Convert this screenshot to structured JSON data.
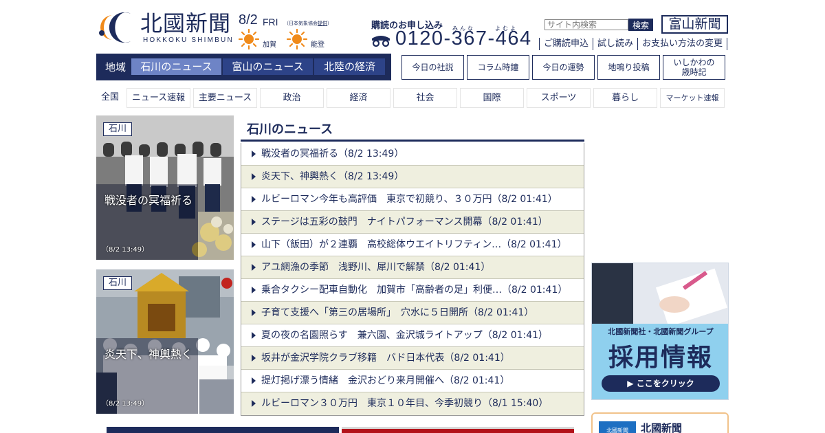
{
  "brand": {
    "name": "北國新聞",
    "romaji": "HOKKOKU SHIMBUN",
    "mark_colors": [
      "#f08a1a",
      "#1d2b5b"
    ]
  },
  "weather": {
    "date": "8/2",
    "day": "FRI",
    "credit_prefix": "（日本気象協会",
    "credit_link": "提供",
    "credit_suffix": "）",
    "cities": [
      {
        "name": "加賀",
        "icon": "sun-icon"
      },
      {
        "name": "能登",
        "icon": "sun-icon"
      }
    ]
  },
  "subscribe": {
    "label": "購読のお申し込み",
    "ruby_1": "みんな",
    "ruby_2": "よむよ",
    "phone": "0120-367-464"
  },
  "search": {
    "placeholder": "サイト内検索",
    "button": "検索"
  },
  "toyama_link": "富山新聞",
  "util_links": [
    "ご購読申込",
    "試し読み",
    "お支払い方法の変更"
  ],
  "region_nav": {
    "label": "地域",
    "tabs": [
      {
        "label": "石川のニュース",
        "active": true
      },
      {
        "label": "富山のニュース",
        "active": false
      },
      {
        "label": "北陸の経済",
        "active": false
      }
    ]
  },
  "column_links": [
    "今日の社説",
    "コラム時鐘",
    "今日の運勢",
    "地鳴り投稿",
    "いしかわの",
    "歳時記"
  ],
  "categories": [
    "全国",
    "ニュース速報",
    "主要ニュース",
    "政治",
    "経済",
    "社会",
    "国際",
    "スポーツ",
    "暮らし",
    "マーケット速報"
  ],
  "photo_stories": [
    {
      "tag": "石川",
      "title": "戦没者の冥福祈る",
      "time": "（8/2 13:49）"
    },
    {
      "tag": "石川",
      "title": "炎天下、神輿熱く",
      "time": "（8/2 13:49）"
    }
  ],
  "news": {
    "heading": "石川のニュース",
    "items": [
      "戦没者の冥福祈る（8/2 13:49）",
      "炎天下、神輿熱く（8/2 13:49）",
      "ルビーロマン今年も高評価　東京で初競り、３０万円（8/2 01:41）",
      "ステージは五彩の鼓門　ナイトパフォーマンス開幕（8/2 01:41）",
      "山下（飯田）が２連覇　高校総体ウエイトリフティン…（8/2 01:41）",
      "アユ網漁の季節　浅野川、犀川で解禁（8/2 01:41）",
      "乗合タクシー配車自動化　加賀市「高齢者の足」利便…（8/2 01:41）",
      "子育て支援へ「第三の居場所」　穴水に５日開所（8/2 01:41）",
      "夏の夜の名園照らす　兼六園、金沢城ライトアップ（8/2 01:41）",
      "坂井が金沢学院クラブ移籍　バド日本代表（8/2 01:41）",
      "提灯掲げ漂う情緒　金沢おどり来月開催へ（8/2 01:41）",
      "ルビーロマン３０万円　東京１０年目、今季初競り（8/1 15:40）"
    ]
  },
  "recruit": {
    "subtitle": "北國新聞社・北國新聞グループ",
    "title": "採用情報",
    "cta": "▶ ここをクリック"
  },
  "paper_card": {
    "logo": "北國新聞",
    "name": "北國新聞"
  },
  "colors": {
    "navy": "#1d2b5b",
    "active_tab": "#6e84c6",
    "row_alt": "#efefdf",
    "sun": "#f08a1a"
  }
}
